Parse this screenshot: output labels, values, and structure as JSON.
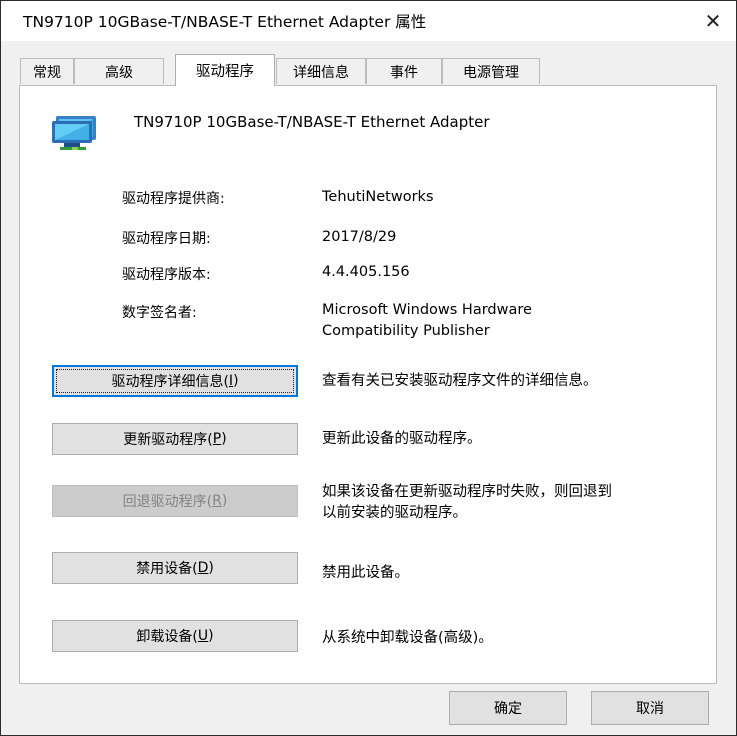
{
  "window": {
    "title": "TN9710P 10GBase-T/NBASE-T Ethernet Adapter 属性",
    "close_glyph": "✕"
  },
  "tabs": [
    {
      "label": "常规"
    },
    {
      "label": "高级"
    },
    {
      "label": "驱动程序",
      "active": true
    },
    {
      "label": "详细信息"
    },
    {
      "label": "事件"
    },
    {
      "label": "电源管理"
    }
  ],
  "device": {
    "icon": "network-adapter-icon",
    "name": "TN9710P 10GBase-T/NBASE-T Ethernet Adapter"
  },
  "info": {
    "provider_label": "驱动程序提供商:",
    "provider_value": "TehutiNetworks",
    "date_label": "驱动程序日期:",
    "date_value": "2017/8/29",
    "version_label": "驱动程序版本:",
    "version_value": "4.4.405.156",
    "signer_label": "数字签名者:",
    "signer_value_line1": "Microsoft Windows Hardware",
    "signer_value_line2": "Compatibility Publisher"
  },
  "actions": {
    "details": {
      "label": "驱动程序详细信息(",
      "key": "I",
      "end": ")",
      "desc": "查看有关已安装驱动程序文件的详细信息。"
    },
    "update": {
      "label": "更新驱动程序(",
      "key": "P",
      "end": ")",
      "desc": "更新此设备的驱动程序。"
    },
    "rollback": {
      "label": "回退驱动程序(",
      "key": "R",
      "end": ")",
      "desc_line1": "如果该设备在更新驱动程序时失败，则回退到",
      "desc_line2": "以前安装的驱动程序。",
      "disabled": true
    },
    "disable": {
      "label": "禁用设备(",
      "key": "D",
      "end": ")",
      "desc": "禁用此设备。"
    },
    "uninstall": {
      "label": "卸载设备(",
      "key": "U",
      "end": ")",
      "desc": "从系统中卸载设备(高级)。"
    }
  },
  "footer": {
    "ok_label": "确定",
    "cancel_label": "取消"
  },
  "colors": {
    "dialog_bg": "#f0f0f0",
    "panel_bg": "#ffffff",
    "button_bg": "#e1e1e1",
    "focus_border": "#0078d7",
    "disabled_text": "#838383"
  }
}
